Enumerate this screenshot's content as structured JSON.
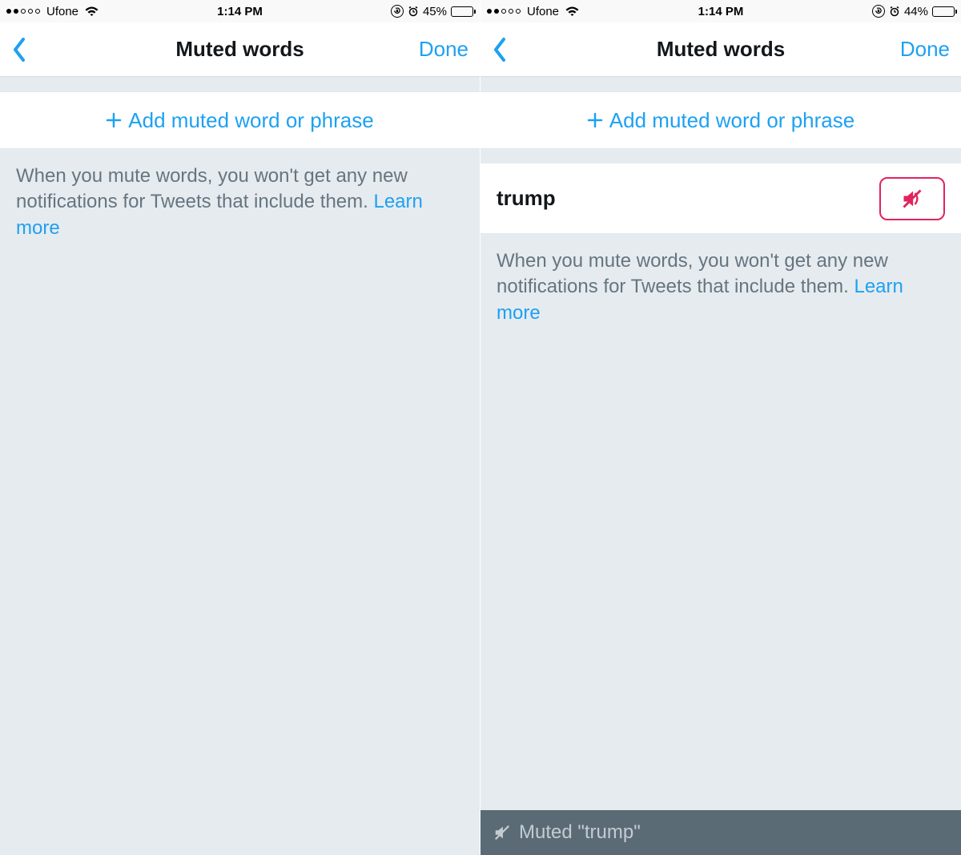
{
  "left": {
    "status": {
      "carrier": "Ufone",
      "time": "1:14 PM",
      "battery_pct": "45%",
      "battery_fill": 0.45,
      "dots_filled": 2
    },
    "nav": {
      "title": "Muted words",
      "done": "Done"
    },
    "add_label": "Add muted word or phrase",
    "info_text": "When you mute words, you won't get any new notifications for Tweets that include them.",
    "learn_more": "Learn more"
  },
  "right": {
    "status": {
      "carrier": "Ufone",
      "time": "1:14 PM",
      "battery_pct": "44%",
      "battery_fill": 0.44,
      "dots_filled": 2
    },
    "nav": {
      "title": "Muted words",
      "done": "Done"
    },
    "add_label": "Add muted word or phrase",
    "muted_word": "trump",
    "info_text": "When you mute words, you won't get any new notifications for Tweets that include them.",
    "learn_more": "Learn more",
    "toast_text": "Muted \"trump\""
  }
}
